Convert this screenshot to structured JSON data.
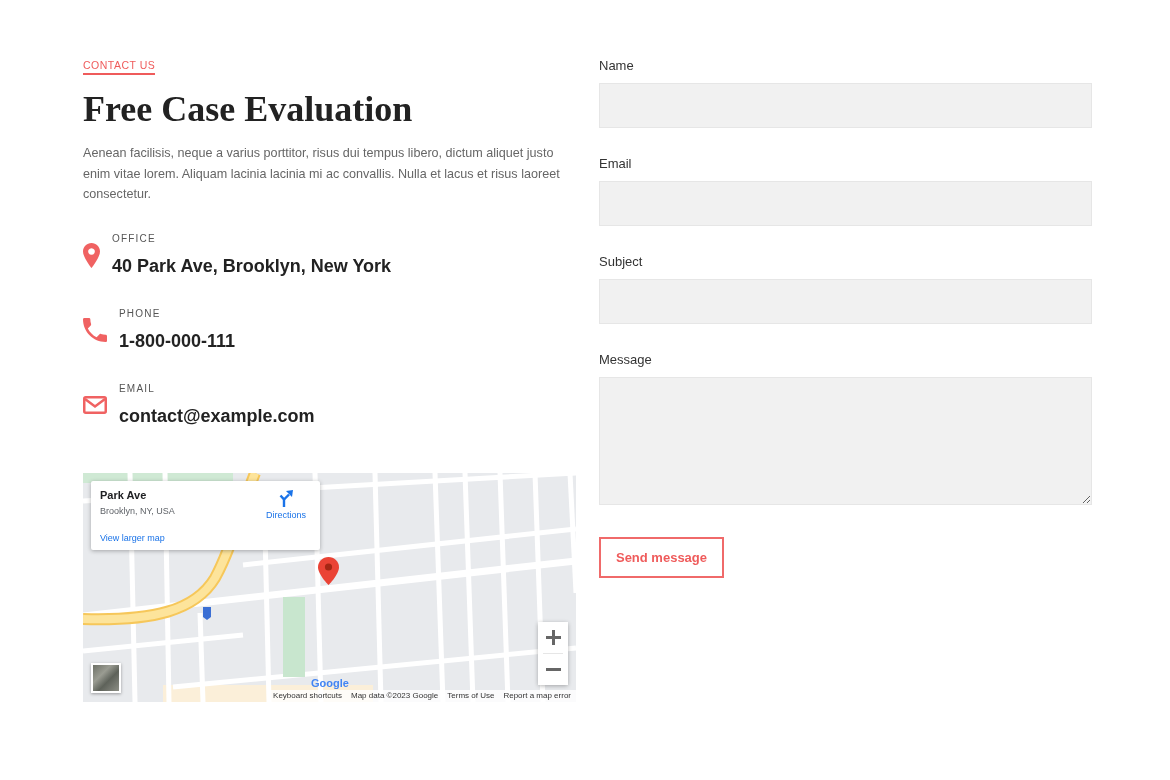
{
  "section_label": "CONTACT US",
  "title": "Free Case Evaluation",
  "intro": "Aenean facilisis, neque a varius porttitor, risus dui tempus libero, dictum aliquet justo enim vitae lorem. Aliquam lacinia lacinia mi ac convallis. Nulla et lacus et risus laoreet consectetur.",
  "contacts": [
    {
      "kind": "office",
      "label": "OFFICE",
      "value": "40 Park Ave, Brooklyn, New York"
    },
    {
      "kind": "phone",
      "label": "PHONE",
      "value": "1-800-000-111"
    },
    {
      "kind": "email",
      "label": "EMAIL",
      "value": "contact@example.com"
    }
  ],
  "map": {
    "place_card": {
      "title": "Park Ave",
      "subtitle": "Brooklyn, NY, USA",
      "directions": "Directions",
      "larger_map_link": "View larger map"
    },
    "logo": "Google",
    "footer": [
      "Keyboard shortcuts",
      "Map data ©2023 Google",
      "Terms of Use",
      "Report a map error"
    ]
  },
  "form": {
    "fields": [
      {
        "kind": "input",
        "label": "Name"
      },
      {
        "kind": "input",
        "label": "Email"
      },
      {
        "kind": "input",
        "label": "Subject"
      },
      {
        "kind": "textarea",
        "label": "Message"
      }
    ],
    "submit": "Send message"
  }
}
